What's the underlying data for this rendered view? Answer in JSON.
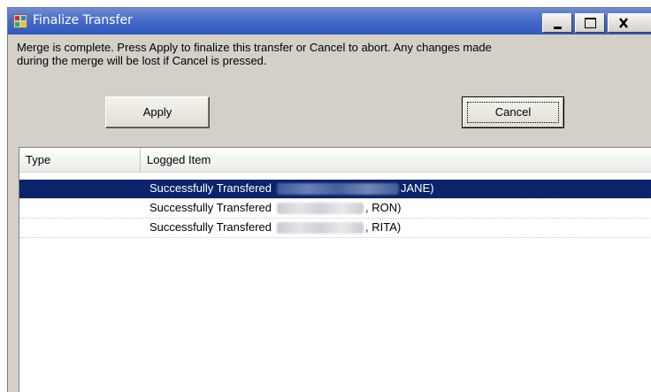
{
  "window": {
    "title": "Finalize Transfer",
    "buttons": {
      "minimize": "_",
      "maximize": "□",
      "close": "X"
    }
  },
  "message": {
    "line1": "Merge is complete.  Press Apply to finalize this transfer or Cancel to abort.  Any changes made",
    "line2": "during the merge will be lost if Cancel is pressed."
  },
  "actions": {
    "apply_label": "Apply",
    "cancel_label": "Cancel"
  },
  "list": {
    "columns": [
      "Type",
      "Logged Item"
    ],
    "rows": [
      {
        "type": "",
        "prefix": "Successfully Transfered",
        "suffix": "JANE)",
        "selected": true
      },
      {
        "type": "",
        "prefix": "Successfully Transfered",
        "suffix": ", RON)",
        "selected": false
      },
      {
        "type": "",
        "prefix": "Successfully Transfered",
        "suffix": ", RITA)",
        "selected": false
      }
    ]
  },
  "colors": {
    "titlebar": "#2f58c0",
    "selection": "#0a246a",
    "dialog_bg": "#d4d0c8"
  },
  "icons": [
    "app-icon",
    "minimize-icon",
    "maximize-icon",
    "close-icon"
  ]
}
